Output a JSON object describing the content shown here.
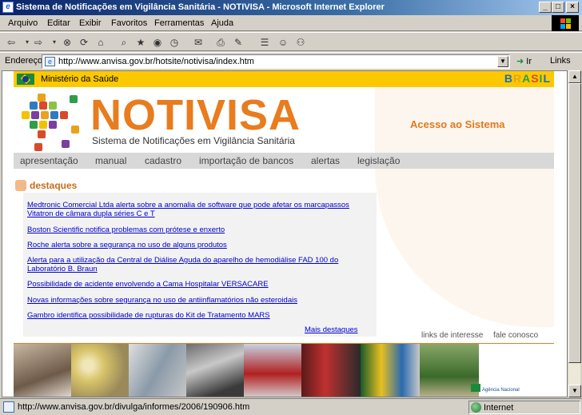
{
  "window": {
    "title": "Sistema de Notificações em Vigilância Sanitária - NOTIVISA - Microsoft Internet Explorer",
    "min": "_",
    "max": "□",
    "close": "×"
  },
  "menu": [
    "Arquivo",
    "Editar",
    "Exibir",
    "Favoritos",
    "Ferramentas",
    "Ajuda"
  ],
  "address": {
    "label": "Endereço",
    "url": "http://www.anvisa.gov.br/hotsite/notivisa/index.htm",
    "go": "Ir",
    "links": "Links"
  },
  "page": {
    "ministerio": "Ministério da Saúde",
    "brasil": "BRASIL",
    "logo": "NOTIVISA",
    "subtitle": "Sistema de Notificações em Vigilância Sanitária",
    "acesso": "Acesso ao Sistema",
    "nav": [
      "apresentação",
      "manual",
      "cadastro",
      "importação de bancos",
      "alertas",
      "legislação"
    ],
    "destaques_title": "destaques",
    "news": [
      "Medtronic Comercial Ltda alerta sobre a anomalia de software que pode afetar os marcapassos Vitatron de câmara dupla séries C e T",
      "Boston Scientific notifica problemas com prótese e enxerto",
      "Roche alerta sobre a segurança no uso de alguns produtos",
      "Alerta para a utilização da Central de Diálise Aguda do aparelho de hemodiálise FAD 100 do Laboratório B. Braun",
      "Possibilidade de acidente envolvendo a Cama Hospitalar VERSACARE",
      "Novas informações sobre segurança no uso de antiinflamatórios não esteroidais",
      "Gambro identifica possibilidade de rupturas do Kit de Tratamento MARS"
    ],
    "mais_destaques": "Mais destaques",
    "links_interesse": "links de interesse",
    "fale_conosco": "fale conosco",
    "agencia": "Agência Nacional"
  },
  "status": {
    "text": "http://www.anvisa.gov.br/divulga/informes/2006/190906.htm",
    "zone": "Internet"
  },
  "colors": {
    "accent": "#e87c1e",
    "link": "#0000cc",
    "title_bar": "#0a246a",
    "gov_yellow": "#fcc900"
  }
}
